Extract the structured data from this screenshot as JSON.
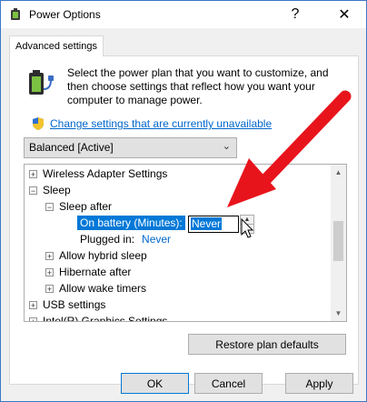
{
  "window": {
    "title": "Power Options",
    "help_glyph": "?",
    "close_glyph": "✕"
  },
  "tab": {
    "label": "Advanced settings"
  },
  "intro": {
    "description": "Select the power plan that you want to customize, and then choose settings that reflect how you want your computer to manage power.",
    "change_link": "Change settings that are currently unavailable"
  },
  "plan": {
    "selected": "Balanced [Active]"
  },
  "tree": {
    "items": [
      {
        "label": "Wireless Adapter Settings",
        "expander": "+"
      },
      {
        "label": "Sleep",
        "expander": "−"
      },
      {
        "label": "Sleep after",
        "expander": "−"
      },
      {
        "label": "On battery (Minutes):",
        "value": "Never"
      },
      {
        "label": "Plugged in:",
        "value": "Never"
      },
      {
        "label": "Allow hybrid sleep",
        "expander": "+"
      },
      {
        "label": "Hibernate after",
        "expander": "+"
      },
      {
        "label": "Allow wake timers",
        "expander": "+"
      },
      {
        "label": "USB settings",
        "expander": "+"
      },
      {
        "label": "Intel(R) Graphics Settings",
        "expander": "+"
      }
    ]
  },
  "buttons": {
    "restore": "Restore plan defaults",
    "ok": "OK",
    "cancel": "Cancel",
    "apply": "Apply"
  },
  "colors": {
    "accent": "#0078d7",
    "link": "#0066cc",
    "arrow": "#e8141c"
  },
  "icons": {
    "app": "power-options-icon",
    "battery": "battery-plug-icon",
    "shield": "uac-shield-icon",
    "arrow": "red-arrow-annotation",
    "cursor": "mouse-cursor-icon"
  }
}
